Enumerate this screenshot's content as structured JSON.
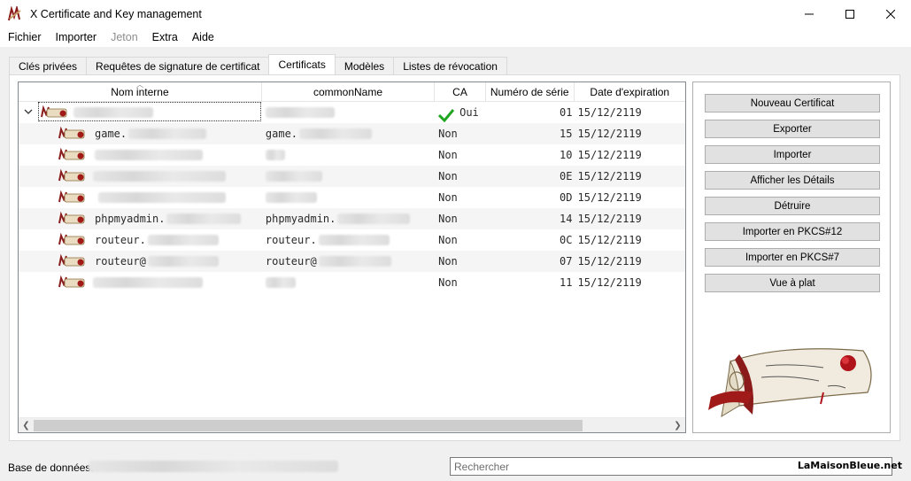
{
  "window": {
    "title": "X Certificate and Key management",
    "app_icon": "xca-app-icon",
    "controls": [
      "minimize-icon",
      "maximize-icon",
      "close-icon"
    ]
  },
  "menu": {
    "items": [
      {
        "label": "Fichier",
        "disabled": false
      },
      {
        "label": "Importer",
        "disabled": false
      },
      {
        "label": "Jeton",
        "disabled": true
      },
      {
        "label": "Extra",
        "disabled": false
      },
      {
        "label": "Aide",
        "disabled": false
      }
    ]
  },
  "tabs": [
    {
      "label": "Clés privées",
      "active": false
    },
    {
      "label": "Requêtes de signature de certificat",
      "active": false
    },
    {
      "label": "Certificats",
      "active": true
    },
    {
      "label": "Modèles",
      "active": false
    },
    {
      "label": "Listes de révocation",
      "active": false
    }
  ],
  "table": {
    "columns": [
      "Nom interne",
      "commonName",
      "CA",
      "Numéro de série",
      "Date d'expiration"
    ],
    "rows": [
      {
        "name": "",
        "cn": "",
        "ca": "Oui",
        "serial": "01",
        "expiry": "15/12/2119",
        "is_root": true
      },
      {
        "name": "game.",
        "cn": "game.",
        "ca": "Non",
        "serial": "15",
        "expiry": "15/12/2119"
      },
      {
        "name": "",
        "cn": "",
        "ca": "Non",
        "serial": "10",
        "expiry": "15/12/2119"
      },
      {
        "name": "",
        "cn": "",
        "ca": "Non",
        "serial": "0E",
        "expiry": "15/12/2119"
      },
      {
        "name": "",
        "cn": "",
        "ca": "Non",
        "serial": "0D",
        "expiry": "15/12/2119"
      },
      {
        "name": "phpmyadmin.",
        "cn": "phpmyadmin.",
        "ca": "Non",
        "serial": "14",
        "expiry": "15/12/2119"
      },
      {
        "name": "routeur.",
        "cn": "routeur.",
        "ca": "Non",
        "serial": "0C",
        "expiry": "15/12/2119"
      },
      {
        "name": "routeur@",
        "cn": "routeur@",
        "ca": "Non",
        "serial": "07",
        "expiry": "15/12/2119"
      },
      {
        "name": "",
        "cn": "",
        "ca": "Non",
        "serial": "11",
        "expiry": "15/12/2119"
      }
    ]
  },
  "actions": [
    "Nouveau Certificat",
    "Exporter",
    "Importer",
    "Afficher les Détails",
    "Détruire",
    "Importer en PKCS#12",
    "Importer en PKCS#7",
    "Vue à plat"
  ],
  "logo": {
    "name": "scroll-logo",
    "accent": "#8b1a1a"
  },
  "status": {
    "db_label": "Base de données:",
    "search_placeholder": "Rechercher",
    "watermark": "LaMaisonBleue.net"
  }
}
